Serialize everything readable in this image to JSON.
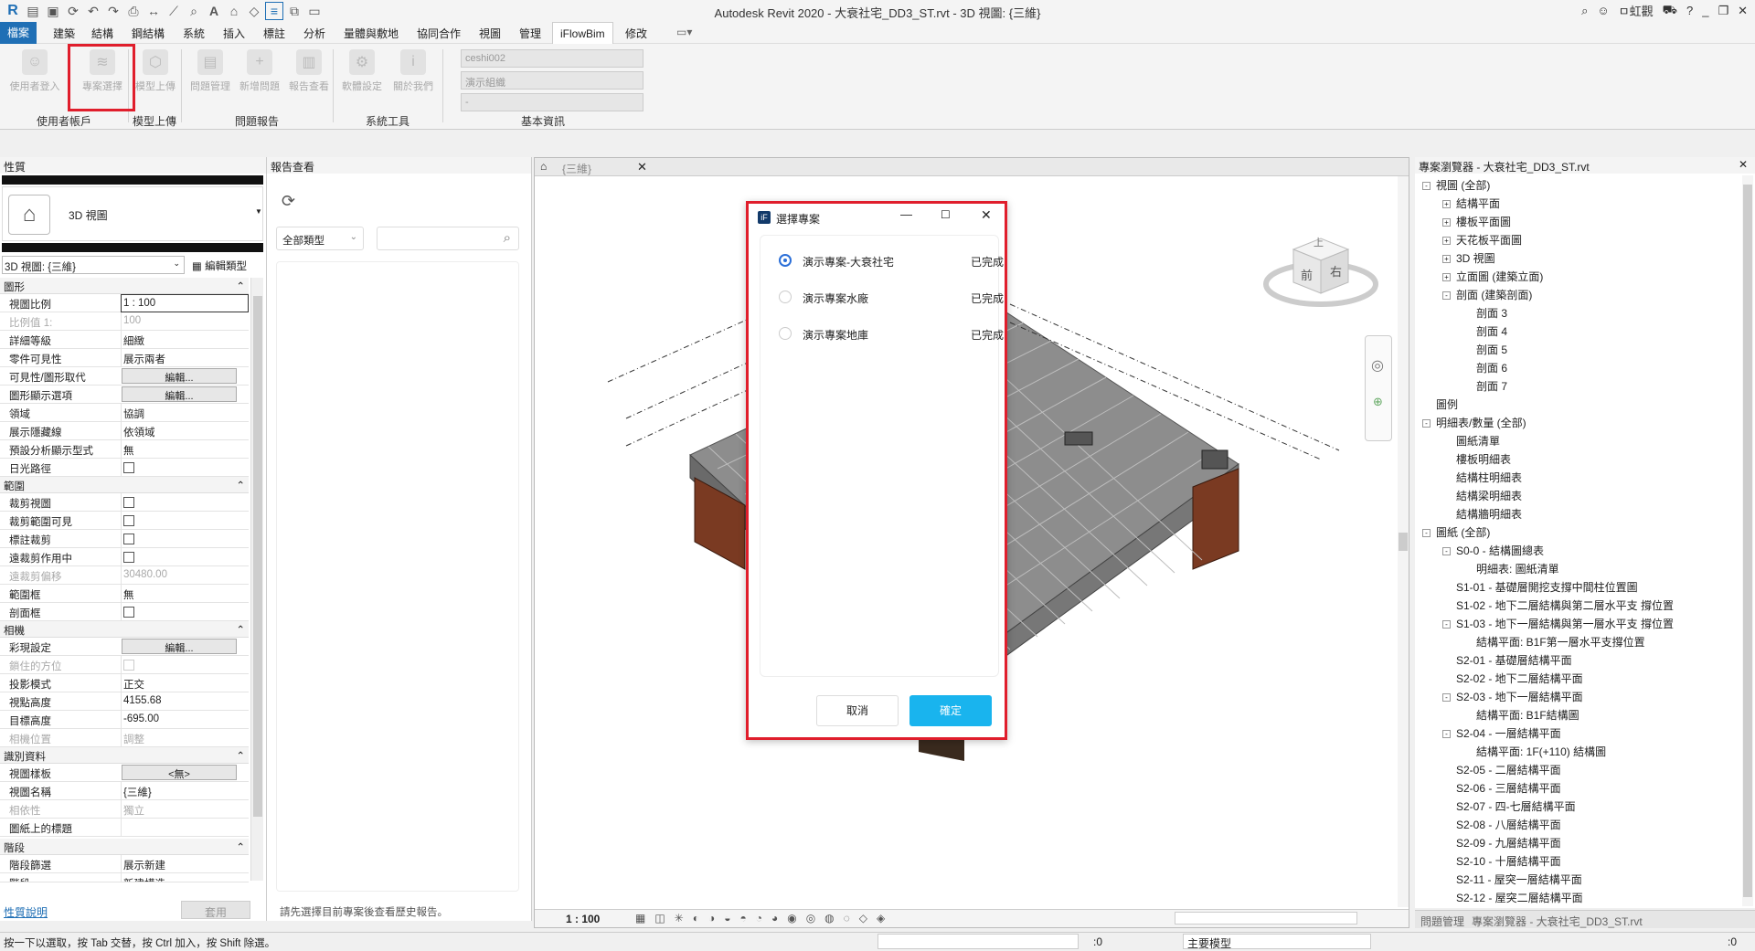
{
  "app": {
    "title": "Autodesk Revit 2020 - 大衰社宅_DD3_ST.rvt - 3D 視圖: {三維}",
    "user": "ㅁ虹觀"
  },
  "menu": [
    "檔案",
    "建築",
    "結構",
    "鋼結構",
    "系統",
    "插入",
    "標註",
    "分析",
    "量體與敷地",
    "協同合作",
    "視圖",
    "管理",
    "iFlowBim",
    "修改"
  ],
  "ribbon": {
    "buttons": [
      "使用者登入",
      "專案選擇",
      "模型上傳",
      "問題管理",
      "新增問題",
      "報告查看",
      "軟體設定",
      "關於我們"
    ],
    "groups": [
      "使用者帳戶",
      "模型上傳",
      "問題報告",
      "系統工具",
      "基本資訊"
    ],
    "info": [
      "ceshi002",
      "演示組織",
      "-"
    ]
  },
  "properties": {
    "title": "性質",
    "type_name": "3D 視圖",
    "instance_select": "3D 視圖: {三維}",
    "edit_type": "編輯類型",
    "categories": [
      "圖形",
      "範圍",
      "相機",
      "識別資料",
      "階段"
    ],
    "rows": [
      {
        "k": "視圖比例",
        "v": "1 : 100"
      },
      {
        "k": "比例值 1:",
        "v": "100"
      },
      {
        "k": "詳細等級",
        "v": "細緻"
      },
      {
        "k": "零件可見性",
        "v": "展示兩者"
      },
      {
        "k": "可見性/圖形取代",
        "v": "編輯..."
      },
      {
        "k": "圖形顯示選項",
        "v": "編輯..."
      },
      {
        "k": "領域",
        "v": "協調"
      },
      {
        "k": "展示隱藏線",
        "v": "依領域"
      },
      {
        "k": "預設分析顯示型式",
        "v": "無"
      },
      {
        "k": "日光路徑",
        "v": ""
      },
      {
        "k": "裁剪視圖",
        "v": ""
      },
      {
        "k": "裁剪範圍可見",
        "v": ""
      },
      {
        "k": "標註裁剪",
        "v": ""
      },
      {
        "k": "遠裁剪作用中",
        "v": ""
      },
      {
        "k": "遠裁剪偏移",
        "v": "30480.00"
      },
      {
        "k": "範圍框",
        "v": "無"
      },
      {
        "k": "剖面框",
        "v": ""
      },
      {
        "k": "彩現設定",
        "v": "編輯..."
      },
      {
        "k": "鎖住的方位",
        "v": ""
      },
      {
        "k": "投影模式",
        "v": "正交"
      },
      {
        "k": "視點高度",
        "v": "4155.68"
      },
      {
        "k": "目標高度",
        "v": "-695.00"
      },
      {
        "k": "相機位置",
        "v": "調整"
      },
      {
        "k": "視圖樣板",
        "v": "<無>"
      },
      {
        "k": "視圖名稱",
        "v": "{三維}"
      },
      {
        "k": "相依性",
        "v": "獨立"
      },
      {
        "k": "圖紙上的標題",
        "v": ""
      },
      {
        "k": "階段篩選",
        "v": "展示新建"
      },
      {
        "k": "階段",
        "v": "新建構造"
      }
    ],
    "help_link": "性質說明",
    "apply": "套用"
  },
  "report": {
    "title": "報告查看",
    "filter": "全部類型",
    "hint": "請先選擇目前專案後查看歷史報告。"
  },
  "viewport": {
    "tab": "{三維}",
    "scale": "1 : 100",
    "cube": [
      "上",
      "前",
      "右"
    ]
  },
  "dialog": {
    "title": "選擇專案",
    "options": [
      {
        "name": "演示專案-大衰社宅",
        "status": "已完成",
        "selected": true
      },
      {
        "name": "演示專案水廠",
        "status": "已完成",
        "selected": false
      },
      {
        "name": "演示專案地庫",
        "status": "已完成",
        "selected": false
      }
    ],
    "cancel": "取消",
    "ok": "確定",
    "ok_color": "#19b4ee"
  },
  "browser": {
    "title": "專案瀏覽器 - 大衰社宅_DD3_ST.rvt",
    "nodes": [
      {
        "t": "視圖 (全部)",
        "d": 0,
        "box": "-"
      },
      {
        "t": "結構平面",
        "d": 1,
        "box": "+"
      },
      {
        "t": "樓板平面圖",
        "d": 1,
        "box": "+"
      },
      {
        "t": "天花板平面圖",
        "d": 1,
        "box": "+"
      },
      {
        "t": "3D 視圖",
        "d": 1,
        "box": "+"
      },
      {
        "t": "立面圖 (建築立面)",
        "d": 1,
        "box": "+"
      },
      {
        "t": "剖面 (建築剖面)",
        "d": 1,
        "box": "-"
      },
      {
        "t": "剖面 3",
        "d": 2,
        "box": ""
      },
      {
        "t": "剖面 4",
        "d": 2,
        "box": ""
      },
      {
        "t": "剖面 5",
        "d": 2,
        "box": ""
      },
      {
        "t": "剖面 6",
        "d": 2,
        "box": ""
      },
      {
        "t": "剖面 7",
        "d": 2,
        "box": ""
      },
      {
        "t": "圖例",
        "d": 0,
        "box": ""
      },
      {
        "t": "明細表/數量 (全部)",
        "d": 0,
        "box": "-"
      },
      {
        "t": "圖紙清單",
        "d": 1,
        "box": ""
      },
      {
        "t": "樓板明細表",
        "d": 1,
        "box": ""
      },
      {
        "t": "結構柱明細表",
        "d": 1,
        "box": ""
      },
      {
        "t": "結構梁明細表",
        "d": 1,
        "box": ""
      },
      {
        "t": "結構牆明細表",
        "d": 1,
        "box": ""
      },
      {
        "t": "圖紙 (全部)",
        "d": 0,
        "box": "-"
      },
      {
        "t": "S0-0 - 結構圖總表",
        "d": 1,
        "box": "-"
      },
      {
        "t": "明細表: 圖紙清單",
        "d": 2,
        "box": ""
      },
      {
        "t": "S1-01 - 基礎層開挖支撐中間柱位置圖",
        "d": 1,
        "box": ""
      },
      {
        "t": "S1-02 - 地下二層結構與第二層水平支 撐位置",
        "d": 1,
        "box": ""
      },
      {
        "t": "S1-03 - 地下一層結構與第一層水平支 撐位置",
        "d": 1,
        "box": "-"
      },
      {
        "t": "結構平面: B1F第一層水平支撐位置",
        "d": 2,
        "box": ""
      },
      {
        "t": "S2-01 - 基礎層結構平面",
        "d": 1,
        "box": ""
      },
      {
        "t": "S2-02 - 地下二層結構平面",
        "d": 1,
        "box": ""
      },
      {
        "t": "S2-03 - 地下一層結構平面",
        "d": 1,
        "box": "-"
      },
      {
        "t": "結構平面: B1F結構圖",
        "d": 2,
        "box": ""
      },
      {
        "t": "S2-04 - 一層結構平面",
        "d": 1,
        "box": "-"
      },
      {
        "t": "結構平面: 1F(+110) 結構圖",
        "d": 2,
        "box": ""
      },
      {
        "t": "S2-05 - 二層結構平面",
        "d": 1,
        "box": ""
      },
      {
        "t": "S2-06 - 三層結構平面",
        "d": 1,
        "box": ""
      },
      {
        "t": "S2-07 - 四-七層結構平面",
        "d": 1,
        "box": ""
      },
      {
        "t": "S2-08 - 八層結構平面",
        "d": 1,
        "box": ""
      },
      {
        "t": "S2-09 - 九層結構平面",
        "d": 1,
        "box": ""
      },
      {
        "t": "S2-10 - 十層結構平面",
        "d": 1,
        "box": ""
      },
      {
        "t": "S2-11 - 屋突一層結構平面",
        "d": 1,
        "box": ""
      },
      {
        "t": "S2-12 - 屋突二層結構平面",
        "d": 1,
        "box": ""
      }
    ],
    "bottom_tabs": [
      "問題管理",
      "專案瀏覽器 - 大衰社宅_DD3_ST.rvt"
    ]
  },
  "status": {
    "hint": "按一下以選取，按 Tab 交替，按 Ctrl 加入，按 Shift 除選。",
    "zero1": ":0",
    "model": "主要模型",
    "zero2": ":0"
  }
}
